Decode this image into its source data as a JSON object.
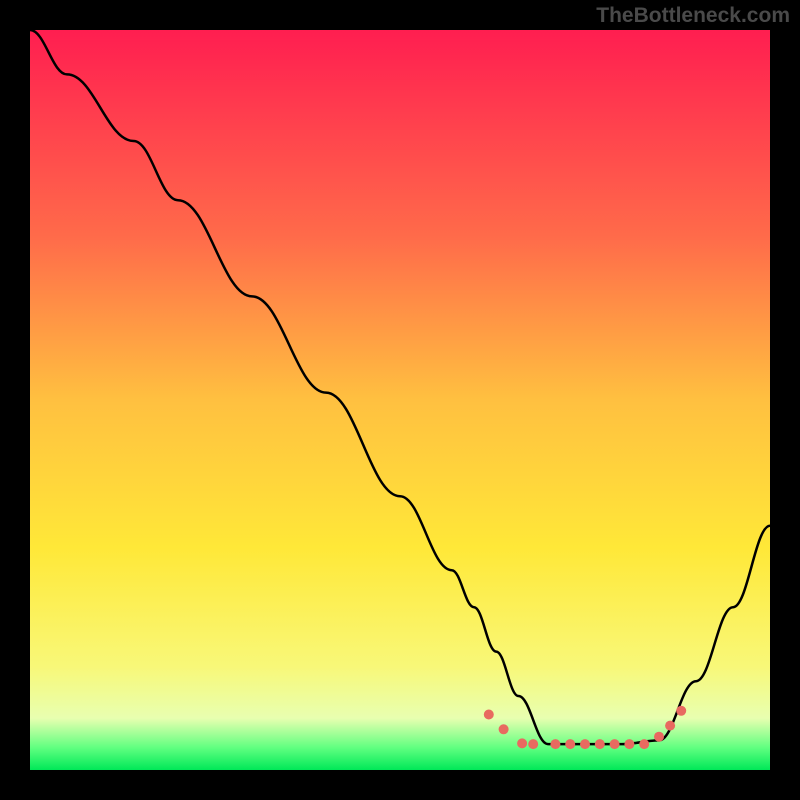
{
  "watermark": "TheBottleneck.com",
  "chart_data": {
    "type": "line",
    "title": "",
    "xlabel": "",
    "ylabel": "",
    "xlim": [
      0,
      100
    ],
    "ylim": [
      0,
      100
    ],
    "gradient_stops": [
      {
        "offset": 0,
        "color": "#ff1e50"
      },
      {
        "offset": 28,
        "color": "#ff6b4a"
      },
      {
        "offset": 50,
        "color": "#ffc040"
      },
      {
        "offset": 70,
        "color": "#ffe838"
      },
      {
        "offset": 86,
        "color": "#f8f878"
      },
      {
        "offset": 93,
        "color": "#e8ffb0"
      },
      {
        "offset": 97,
        "color": "#60ff80"
      },
      {
        "offset": 100,
        "color": "#00e858"
      }
    ],
    "series": [
      {
        "name": "bottleneck-curve",
        "color": "#000000",
        "x": [
          0,
          5,
          14,
          20,
          30,
          40,
          50,
          57,
          60,
          63,
          66,
          70,
          75,
          80,
          85,
          90,
          95,
          100
        ],
        "y": [
          100,
          94,
          85,
          77,
          64,
          51,
          37,
          27,
          22,
          16,
          10,
          3.5,
          3.5,
          3.5,
          4,
          12,
          22,
          33
        ]
      }
    ],
    "markers": {
      "color": "#e86a60",
      "radius": 5,
      "points": [
        {
          "x": 62,
          "y": 7.5
        },
        {
          "x": 64,
          "y": 5.5
        },
        {
          "x": 66.5,
          "y": 3.6
        },
        {
          "x": 68,
          "y": 3.5
        },
        {
          "x": 71,
          "y": 3.5
        },
        {
          "x": 73,
          "y": 3.5
        },
        {
          "x": 75,
          "y": 3.5
        },
        {
          "x": 77,
          "y": 3.5
        },
        {
          "x": 79,
          "y": 3.5
        },
        {
          "x": 81,
          "y": 3.5
        },
        {
          "x": 83,
          "y": 3.5
        },
        {
          "x": 85,
          "y": 4.5
        },
        {
          "x": 86.5,
          "y": 6
        },
        {
          "x": 88,
          "y": 8
        }
      ]
    }
  }
}
